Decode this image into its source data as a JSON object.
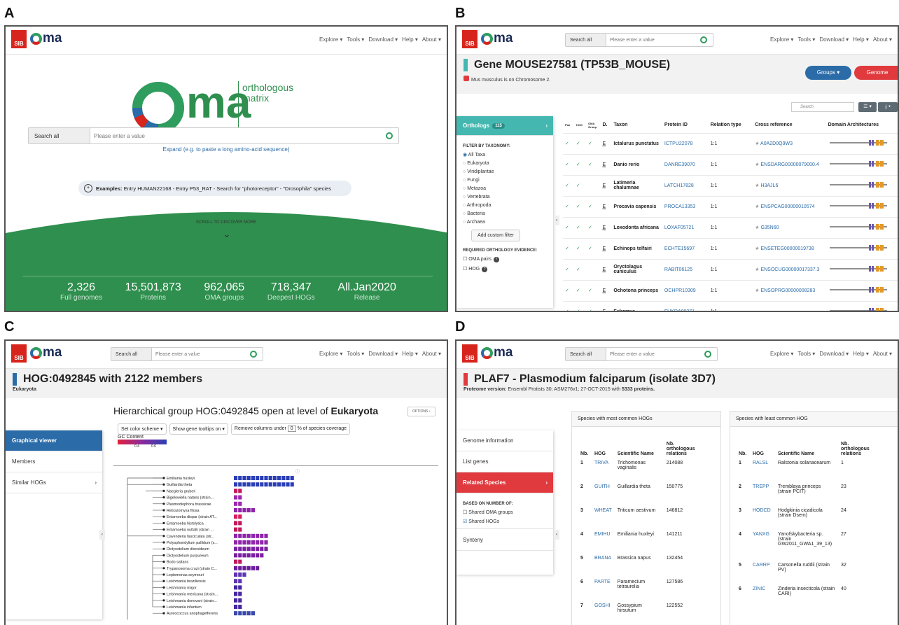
{
  "labels": {
    "a": "A",
    "b": "B",
    "c": "C",
    "d": "D"
  },
  "common": {
    "sib": "SIB",
    "oma": "ma",
    "browser": "browser",
    "search_mode": "Search all",
    "search_placeholder": "Please enter a value",
    "nav": [
      "Explore ▾",
      "Tools ▾",
      "Download ▾",
      "Help ▾",
      "About ▾"
    ]
  },
  "a": {
    "brand_word": "ma",
    "brand_sub": "browser",
    "brand_right1": "orthologous",
    "brand_right2": "matrix",
    "expand": "Expand (e.g. to paste a long amino-acid sequence)",
    "examples_label": "Examples:",
    "examples": "Entry HUMAN22168 - Entry P53_RAT - Search for \"photoreceptor\" - \"Drosophila\" species",
    "scroll": "SCROLL TO DISCOVER MORE",
    "stats": [
      {
        "v": "2,326",
        "l": "Full genomes"
      },
      {
        "v": "15,501,873",
        "l": "Proteins"
      },
      {
        "v": "962,065",
        "l": "OMA groups"
      },
      {
        "v": "718,347",
        "l": "Deepest HOGs"
      },
      {
        "v": "All.Jan2020",
        "l": "Release"
      }
    ]
  },
  "b": {
    "title": "Gene MOUSE27581 (TP53B_MOUSE)",
    "subtitle": "Mus musculus is on Chromosome 2.",
    "groups_btn": "Groups ▾",
    "genome_btn": "Genome",
    "table_search": "Search",
    "side_title": "Orthologs",
    "side_count": "115",
    "filter_title": "FILTER BY TAXONOMY:",
    "taxa": [
      "All Taxa",
      "Eukaryota",
      "Viridiplantae",
      "Fungi",
      "Metazoa",
      "Vertebrata",
      "Arthropoda",
      "Bacteria",
      "Archaea"
    ],
    "custom_filter": "Add custom filter",
    "evidence_title": "REQUIRED ORTHOLOGY EVIDENCE:",
    "evidence": [
      "OMA pairs",
      "HOG"
    ],
    "cols": [
      "Pair",
      "HOG",
      "OMA Group",
      "D.",
      "Taxon",
      "Protein ID",
      "Relation type",
      "Cross reference",
      "Domain Architectures"
    ],
    "rows": [
      {
        "pair": "✓",
        "hog": "✓",
        "grp": "✓",
        "d": "E",
        "taxon": "Ictalurus punctatus",
        "pid": "ICTPU22078",
        "rel": "1:1",
        "xref": "A0A2D0Q9W3"
      },
      {
        "pair": "✓",
        "hog": "✓",
        "grp": "✓",
        "d": "E",
        "taxon": "Danio rerio",
        "pid": "DANRE39070",
        "rel": "1:1",
        "xref": "ENSDARG00000079000.4"
      },
      {
        "pair": "✓",
        "hog": "✓",
        "grp": "",
        "d": "E",
        "taxon": "Latimeria chalumnae",
        "pid": "LATCH17828",
        "rel": "1:1",
        "xref": "H3AJL6"
      },
      {
        "pair": "✓",
        "hog": "✓",
        "grp": "✓",
        "d": "E",
        "taxon": "Procavia capensis",
        "pid": "PROCA13353",
        "rel": "1:1",
        "xref": "ENSPCAG00000010574"
      },
      {
        "pair": "✓",
        "hog": "✓",
        "grp": "✓",
        "d": "E",
        "taxon": "Loxodonta africana",
        "pid": "LOXAF05721",
        "rel": "1:1",
        "xref": "G35N60"
      },
      {
        "pair": "✓",
        "hog": "✓",
        "grp": "✓",
        "d": "E",
        "taxon": "Echinops telfairi",
        "pid": "ECHTE15697",
        "rel": "1:1",
        "xref": "ENSETEG00000019738"
      },
      {
        "pair": "✓",
        "hog": "✓",
        "grp": "",
        "d": "E",
        "taxon": "Oryctolagus cuniculus",
        "pid": "RABIT06125",
        "rel": "1:1",
        "xref": "ENSOCUG00000017337.3"
      },
      {
        "pair": "✓",
        "hog": "✓",
        "grp": "✓",
        "d": "E",
        "taxon": "Ochotona princeps",
        "pid": "OCHPR10309",
        "rel": "1:1",
        "xref": "ENSOPRG00000008283"
      },
      {
        "pair": "✓",
        "hog": "✓",
        "grp": "✓",
        "d": "E",
        "taxon": "Fukomys",
        "pid": "FUKDA00271",
        "rel": "1:1",
        "xref": ""
      }
    ]
  },
  "c": {
    "title": "HOG:0492845 with 2122 members",
    "subtitle": "Eukaryota",
    "heading_pre": "Hierarchical group HOG:0492845 open at level of ",
    "heading_bold": "Eukaryota",
    "options": "OPTIONS ›",
    "ctl1": "Set color scheme ▾",
    "ctl2": "Show gene tooltips on ▾",
    "ctl3": "Remove columns under",
    "ctl3_val": "0",
    "ctl3_post": "% of species coverage",
    "legend_title": "GC Content",
    "legend_t1": "0.4",
    "legend_t2": "0.6",
    "side": [
      "Graphical viewer",
      "Members",
      "Similar HOGs"
    ],
    "species": [
      {
        "n": "Emiliania huxleyi",
        "c": 14
      },
      {
        "n": "Guillardia theta",
        "c": 14
      },
      {
        "n": "Naegleria gruberi",
        "c": 2
      },
      {
        "n": "Bigelowiella natans (strain...",
        "c": 2
      },
      {
        "n": "Plasmodiophora brassicae",
        "c": 2
      },
      {
        "n": "Reticulomyxa filosa",
        "c": 5
      },
      {
        "n": "Entamoeba dispar (strain AT...",
        "c": 2
      },
      {
        "n": "Entamoeba histolytica",
        "c": 2
      },
      {
        "n": "Entamoeba nuttalli (strain ...",
        "c": 2
      },
      {
        "n": "Cavenderia fasciculata (str...",
        "c": 8
      },
      {
        "n": "Polysphondylium pallidum (s...",
        "c": 8
      },
      {
        "n": "Dictyostelium discoideum",
        "c": 8
      },
      {
        "n": "Dictyostelium purpureum",
        "c": 7
      },
      {
        "n": "Bodo saltans",
        "c": 2
      },
      {
        "n": "Trypanosoma cruzi (strain C...",
        "c": 6
      },
      {
        "n": "Leptomonas seymouri",
        "c": 3
      },
      {
        "n": "Leishmania braziliensis",
        "c": 2
      },
      {
        "n": "Leishmania major",
        "c": 2
      },
      {
        "n": "Leishmania mexicana (strain...",
        "c": 2
      },
      {
        "n": "Leishmania donovani (strain...",
        "c": 2
      },
      {
        "n": "Leishmania infantum",
        "c": 2
      },
      {
        "n": "Aureococcus anophagefferens",
        "c": 5
      }
    ]
  },
  "d": {
    "title": "PLAF7 - Plasmodium falciparum (isolate 3D7)",
    "sub_label": "Proteome version:",
    "sub_text": " Ensembl Protists 30; ASM276v1; 27-OCT-2015 with ",
    "sub_bold": "5333 proteins.",
    "side": [
      "Genome information",
      "List genes",
      "Related Species"
    ],
    "based_title": "BASED ON NUMBER OF:",
    "based": [
      "Shared OMA groups",
      "Shared HOGs"
    ],
    "synteny": "Synteny",
    "most_title": "Species with most common HOGs",
    "least_title": "Species with least common HOG",
    "cols": [
      "Nb.",
      "HOG",
      "Scientific Name",
      "Nb. orthologous relations"
    ],
    "most": [
      {
        "nb": "1",
        "hog": "TRIVA",
        "name": "Trichomonas vaginalis",
        "rel": "214088"
      },
      {
        "nb": "2",
        "hog": "GUITH",
        "name": "Guillardia theta",
        "rel": "150775"
      },
      {
        "nb": "3",
        "hog": "WHEAT",
        "name": "Triticum aestivum",
        "rel": "146812"
      },
      {
        "nb": "4",
        "hog": "EMIHU",
        "name": "Emiliania huxleyi",
        "rel": "141211"
      },
      {
        "nb": "5",
        "hog": "BRANA",
        "name": "Brassica napus",
        "rel": "132454"
      },
      {
        "nb": "6",
        "hog": "PARTE",
        "name": "Paramecium tetraurelia",
        "rel": "127586"
      },
      {
        "nb": "7",
        "hog": "GOSHI",
        "name": "Gossypium hirsutum",
        "rel": "122552"
      }
    ],
    "least": [
      {
        "nb": "1",
        "hog": "RALSL",
        "name": "Ralstonia solanacearum",
        "rel": "1"
      },
      {
        "nb": "2",
        "hog": "TREPP",
        "name": "Tremblaya princeps (strain PCIT)",
        "rel": "23"
      },
      {
        "nb": "3",
        "hog": "HODCD",
        "name": "Hodgkinia cicadicola (strain Dsem)",
        "rel": "24"
      },
      {
        "nb": "4",
        "hog": "YANXG",
        "name": "Yanofskybacteria sp. (strain GW2011_GWA1_39_13)",
        "rel": "27"
      },
      {
        "nb": "5",
        "hog": "CARRP",
        "name": "Carsonella ruddii (strain PV)",
        "rel": "32"
      },
      {
        "nb": "6",
        "hog": "ZINIC",
        "name": "Zinderia insecticola (strain CARI)",
        "rel": "40"
      }
    ]
  },
  "colors": {
    "oma_green": "#2f8f4e",
    "blue": "#2a6ba8",
    "red": "#e03a3e",
    "teal": "#44b8b0"
  }
}
